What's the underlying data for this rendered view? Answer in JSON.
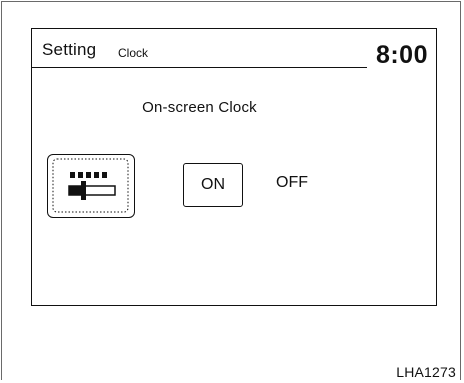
{
  "header": {
    "title": "Setting",
    "subtitle": "Clock",
    "time": "8:00"
  },
  "section": {
    "title": "On-screen Clock"
  },
  "icons": {
    "adjust": "adjust-slider-icon"
  },
  "options": {
    "on_label": "ON",
    "off_label": "OFF",
    "selected": "ON"
  },
  "figure": {
    "code": "LHA1273"
  }
}
